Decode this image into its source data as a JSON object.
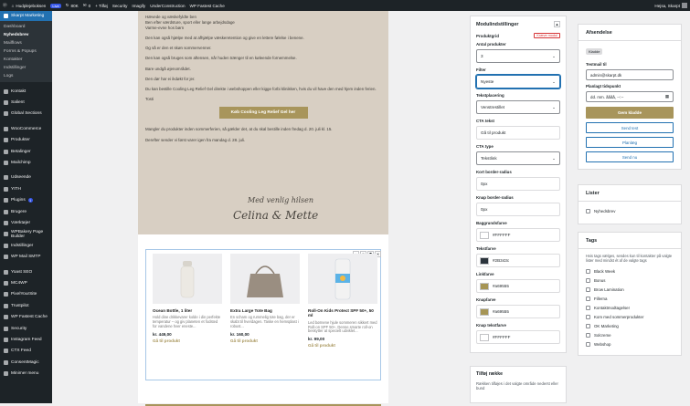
{
  "adminbar": {
    "site": "Hudplejeboksen",
    "live": "Live",
    "comments_count": "0",
    "updates_label": "80K",
    "new_label": "0",
    "add_label": "+ Tilføj",
    "security": "Security",
    "imagify": "Imagify",
    "underconstruction": "UnderConstruction",
    "cache": "WP Fastest Cache",
    "greeting": "Hejsa, Skarpt"
  },
  "sidebar": {
    "active": "Skarpt Marketing",
    "submenu": [
      "Dashboard",
      "Nyhedsbrev",
      "Mailflows",
      "Forms & Popups",
      "Kontakter",
      "Indstillinger",
      "Logs"
    ],
    "items": [
      {
        "label": "Kontakt"
      },
      {
        "label": "Salient"
      },
      {
        "label": "Global Sections"
      },
      {
        "label": "WooCommerce"
      },
      {
        "label": "Produkter"
      },
      {
        "label": "Betalinger"
      },
      {
        "label": "Mailchimp"
      },
      {
        "label": "Udseende"
      },
      {
        "label": "YITH"
      },
      {
        "label": "Plugins",
        "count": "1"
      },
      {
        "label": "Brugere"
      },
      {
        "label": "Værktøjer"
      },
      {
        "label": "WPBakery Page Builder"
      },
      {
        "label": "Indstillinger"
      },
      {
        "label": "WP Mail SMTP"
      },
      {
        "label": "Yoast SEO"
      },
      {
        "label": "MC4WP"
      },
      {
        "label": "PixelYourSite"
      },
      {
        "label": "Trustpilot"
      },
      {
        "label": "WP Fastest Cache"
      },
      {
        "label": "Security"
      },
      {
        "label": "Instagram Feed"
      },
      {
        "label": "CTX Feed"
      },
      {
        "label": "ConsentMagic"
      },
      {
        "label": "Minimer menu"
      }
    ]
  },
  "email": {
    "paragraphs": [
      "Hævede og væskefyldte ben",
      "Ben efter værdsture, sport eller lange arbejdsdage",
      "Varme-evne hos børn",
      "Den kan også hjælpe med at afhjælpe væskeretention og give en lettere følelse i benene.",
      "Og så er den et skøn sommervenner.",
      "Den kan også bruges som aftensen, når huden trænger til en køleende fornemmelse.",
      "Bare undgå øjenområdet.",
      "Den dør har ei ikdøkt for jer.",
      "Du kan bestille Cooling Leg Relief Gel direkte i webshoppen eller kigge forbi klinikken, hvis du vil have den med hjem inden ferien.",
      "Tosti"
    ],
    "cta": "Køb Cooling Leg Relief Gel her",
    "after": [
      "Mangler du produkter inden sommerferien, så gælder det, at du skal bestille inden fredag d. 20. juli kl. 15.",
      "Derefter sender vi først varer igen fra mandag d. 28. juli."
    ],
    "signature_line1": "Med venlig hilsen",
    "signature_line2": "Celina & Mette"
  },
  "products": [
    {
      "name": "Ocean Bottle, 1 liter",
      "desc": "Hold dine drikkevarer kolde i din perfekte temperatur – og giv planeten et fodsted for vandene hver eneste...",
      "price": "kr. 449,00",
      "link": "Gå til produkt"
    },
    {
      "name": "Extra Large Tote Bag",
      "desc": "En scham og rummelig tote bag, der er skabt til hverdagen. Taske en hemsplast i robust...",
      "price": "kr. 160,00",
      "link": "Gå til produkt"
    },
    {
      "name": "Roll-On Kids Protect SPF 50+, 50 ml",
      "desc": "Led børnene hjule sommeren sikkert med Roll-on SPF 50+. Denne smarte roll-on beskytter at specielt udviklet...",
      "price": "kr. 99,00",
      "link": "Gå til produkt"
    }
  ],
  "toolbar": {
    "up": "▲",
    "down": "▼",
    "copy": "⧉",
    "delete": "✕"
  },
  "modul": {
    "title": "Modulindstillinger",
    "produktgrid": "Produktgrid",
    "req": "Kræve modul",
    "antal_label": "Antal produkter",
    "antal_value": "3",
    "filter_label": "Filter",
    "filter_value": "Nyeste",
    "tekst_label": "Tekstplacering",
    "tekst_value": "Venstrestillet",
    "cta_label": "CTA tekst",
    "cta_value": "Gå til produkt",
    "ctatype_label": "CTA type",
    "ctatype_value": "Tekstlink",
    "kort_label": "Kort border-radius",
    "kort_value": "0px",
    "knap_label": "Knap border-radius",
    "knap_value": "0px",
    "colors": [
      {
        "label": "Baggrundsfarve",
        "value": "#FFFFFF",
        "swatch": "#ffffff"
      },
      {
        "label": "Tekstfarve",
        "value": "#2B343c",
        "swatch": "#2b343c"
      },
      {
        "label": "Linkfarve",
        "value": "#a69555",
        "swatch": "#a69555"
      },
      {
        "label": "Knapfarve",
        "value": "#a69555",
        "swatch": "#a69555"
      },
      {
        "label": "Knap tekstfarve",
        "value": "#FFFFFF",
        "swatch": "#ffffff"
      }
    ]
  },
  "tilfoj": {
    "title": "Tilføj række",
    "desc": "Rækken tilføjes i det valgte område nederst eller bund"
  },
  "afsendelse": {
    "title": "Afsendelse",
    "tag": "Kladde",
    "testmail_label": "Testmail til",
    "testmail_value": "admin@skarpt.dk",
    "planlaeg_label": "Planlagt tidspunkt",
    "planlaeg_value": "dd. mm. åååå, --:--",
    "gem": "Gem kladde",
    "send_test": "Send test",
    "planlaeg_btn": "Planlæg",
    "send_nu": "Send nu"
  },
  "lister": {
    "title": "Lister",
    "items": [
      "Nyhedsbrev"
    ]
  },
  "tags": {
    "title": "Tags",
    "desc": "Hvis tags vælges, sendes kun til kontakter på valgte lister med mindst ét af de valgte tags",
    "items": [
      "Black Week",
      "Bonus",
      "Brow Lamination",
      "Fillerna",
      "Kontaktmodtagelser",
      "Kom med sommerprodukter",
      "OK Marketing",
      "Solcreme",
      "Webshop"
    ]
  },
  "colors": {
    "accent": "#a8955b",
    "wp_blue": "#2271b1",
    "admin_dark": "#1d2327"
  }
}
